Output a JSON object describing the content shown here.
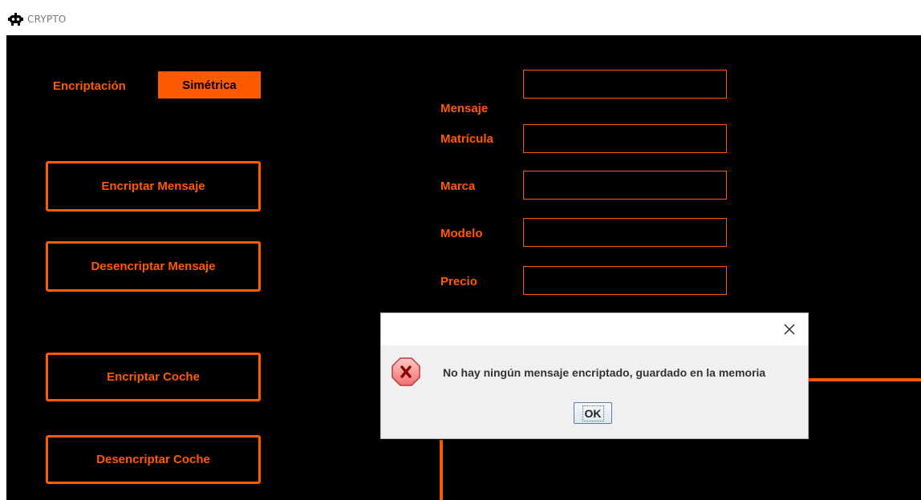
{
  "window": {
    "title": "CRYPTO",
    "icon": "robot-icon"
  },
  "colors": {
    "accent": "#ff5a00",
    "background": "#000000"
  },
  "encryption": {
    "label": "Encriptación",
    "mode": "Simétrica"
  },
  "buttons": {
    "encrypt_message": "Encriptar Mensaje",
    "decrypt_message": "Desencriptar Mensaje",
    "encrypt_car": "Encriptar Coche",
    "decrypt_car": "Desencriptar Coche"
  },
  "fields": {
    "mensaje": {
      "label": "Mensaje",
      "value": ""
    },
    "matricula": {
      "label": "Matrícula",
      "value": ""
    },
    "marca": {
      "label": "Marca",
      "value": ""
    },
    "modelo": {
      "label": "Modelo",
      "value": ""
    },
    "precio": {
      "label": "Precio",
      "value": ""
    }
  },
  "dialog": {
    "icon": "error-icon",
    "message": "No hay ningún mensaje encriptado, guardado en la memoria",
    "ok_label": "OK",
    "close_glyph": "×"
  }
}
